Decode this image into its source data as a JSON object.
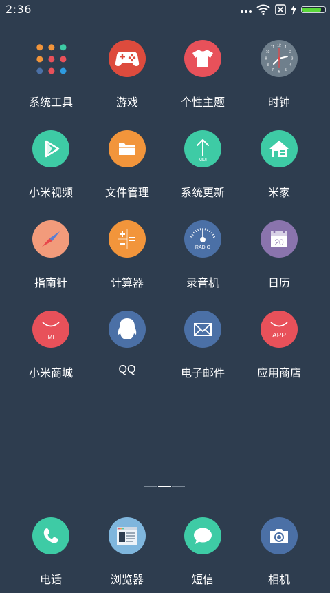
{
  "status_bar": {
    "time": "2:36",
    "icons": [
      "more-dots-icon",
      "wifi-icon",
      "sim-error-icon",
      "charging-bolt-icon",
      "battery-icon"
    ],
    "battery_level": 0.9,
    "battery_color": "#5ad83a"
  },
  "home": {
    "apps": [
      {
        "label": "系统工具",
        "icon": "folder-grid-icon",
        "color": "#2e3d4f"
      },
      {
        "label": "游戏",
        "icon": "gamepad-icon",
        "color": "#dd4b3d"
      },
      {
        "label": "个性主题",
        "icon": "tshirt-icon",
        "color": "#e8515a"
      },
      {
        "label": "时钟",
        "icon": "clock-icon",
        "color": "#6f7f8c"
      },
      {
        "label": "小米视频",
        "icon": "video-play-icon",
        "color": "#3ecba5"
      },
      {
        "label": "文件管理",
        "icon": "folder-icon",
        "color": "#f2953b"
      },
      {
        "label": "系统更新",
        "icon": "update-arrow-icon",
        "color": "#3ecba5"
      },
      {
        "label": "米家",
        "icon": "smart-home-icon",
        "color": "#3ecba5"
      },
      {
        "label": "指南针",
        "icon": "compass-icon",
        "color": "#f29b7b"
      },
      {
        "label": "计算器",
        "icon": "calculator-icon",
        "color": "#f2953b"
      },
      {
        "label": "录音机",
        "icon": "radio-icon",
        "color": "#4b70a6"
      },
      {
        "label": "日历",
        "icon": "calendar-icon",
        "color": "#8a74ad"
      },
      {
        "label": "小米商城",
        "icon": "mi-store-icon",
        "color": "#e8515a"
      },
      {
        "label": "QQ",
        "icon": "qq-penguin-icon",
        "color": "#4b70a6"
      },
      {
        "label": "电子邮件",
        "icon": "mail-envelope-icon",
        "color": "#4b70a6"
      },
      {
        "label": "应用商店",
        "icon": "app-store-icon",
        "color": "#e8515a"
      }
    ],
    "icon_text": {
      "update": "MIUI",
      "radio": "RADIO",
      "calendar_day": "20",
      "mi_store": "MI",
      "app_store": "APP"
    },
    "page_indicator": {
      "pages": 3,
      "current": 2
    }
  },
  "dock": {
    "apps": [
      {
        "label": "电话",
        "icon": "phone-icon",
        "color": "#3ecba5"
      },
      {
        "label": "浏览器",
        "icon": "browser-icon",
        "color": "#7fb6dd"
      },
      {
        "label": "短信",
        "icon": "message-bubble-icon",
        "color": "#3ecba5"
      },
      {
        "label": "相机",
        "icon": "camera-icon",
        "color": "#4b70a6"
      }
    ]
  }
}
